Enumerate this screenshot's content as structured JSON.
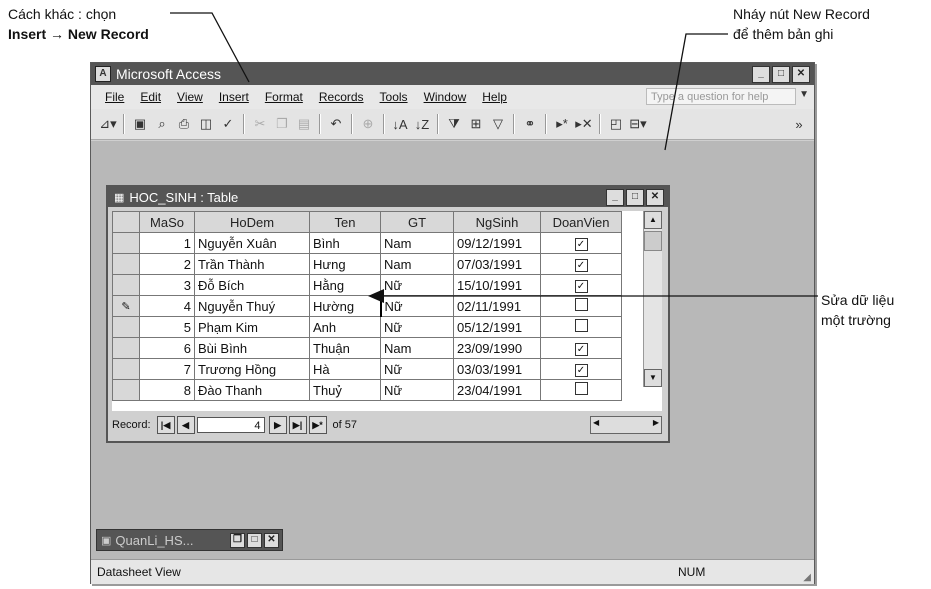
{
  "annotations": {
    "left_line1": "Cách khác : chọn",
    "left_line2": "Insert → New Record",
    "right_top_line1": "Nháy nút New Record",
    "right_top_line2": "để thêm bản ghi",
    "right_mid_line1": "Sửa dữ liệu",
    "right_mid_line2": "một trường"
  },
  "window": {
    "title": "Microsoft Access",
    "menu": [
      "File",
      "Edit",
      "View",
      "Insert",
      "Format",
      "Records",
      "Tools",
      "Window",
      "Help"
    ],
    "help_placeholder": "Type a question for help"
  },
  "toolbar_icons": [
    "view-icon",
    "save-icon",
    "search-icon",
    "print-icon",
    "print-preview-icon",
    "spelling-icon",
    "cut-icon",
    "copy-icon",
    "paste-icon",
    "undo-icon",
    "hyperlink-icon",
    "sort-asc-icon",
    "sort-desc-icon",
    "filter-selection-icon",
    "filter-form-icon",
    "apply-filter-icon",
    "find-icon",
    "new-record-icon",
    "delete-record-icon",
    "database-window-icon",
    "new-object-icon"
  ],
  "table_window": {
    "title": "HOC_SINH : Table",
    "columns": [
      "MaSo",
      "HoDem",
      "Ten",
      "GT",
      "NgSinh",
      "DoanVien"
    ],
    "rows": [
      {
        "selector": "",
        "MaSo": "1",
        "HoDem": "Nguyễn Xuân",
        "Ten": "Bình",
        "GT": "Nam",
        "NgSinh": "09/12/1991",
        "DoanVien": true
      },
      {
        "selector": "",
        "MaSo": "2",
        "HoDem": "Trần Thành",
        "Ten": "Hưng",
        "GT": "Nam",
        "NgSinh": "07/03/1991",
        "DoanVien": true
      },
      {
        "selector": "",
        "MaSo": "3",
        "HoDem": "Đỗ Bích",
        "Ten": "Hằng",
        "GT": "Nữ",
        "NgSinh": "15/10/1991",
        "DoanVien": true
      },
      {
        "selector": "✎",
        "MaSo": "4",
        "HoDem": "Nguyễn Thuý",
        "Ten": "Hường",
        "GT": "Nữ",
        "NgSinh": "02/11/1991",
        "DoanVien": false
      },
      {
        "selector": "",
        "MaSo": "5",
        "HoDem": "Phạm Kim",
        "Ten": "Anh",
        "GT": "Nữ",
        "NgSinh": "05/12/1991",
        "DoanVien": false
      },
      {
        "selector": "",
        "MaSo": "6",
        "HoDem": "Bùi Bình",
        "Ten": "Thuận",
        "GT": "Nam",
        "NgSinh": "23/09/1990",
        "DoanVien": true
      },
      {
        "selector": "",
        "MaSo": "7",
        "HoDem": "Trương Hồng",
        "Ten": "Hà",
        "GT": "Nữ",
        "NgSinh": "03/03/1991",
        "DoanVien": true
      },
      {
        "selector": "",
        "MaSo": "8",
        "HoDem": "Đào Thanh",
        "Ten": "Thuỷ",
        "GT": "Nữ",
        "NgSinh": "23/04/1991",
        "DoanVien": false
      }
    ],
    "navigation": {
      "label": "Record:",
      "current": "4",
      "total_text": "of 57"
    }
  },
  "minimized_window": {
    "title": "QuanLi_HS..."
  },
  "statusbar": {
    "left": "Datasheet View",
    "right": "NUM"
  }
}
